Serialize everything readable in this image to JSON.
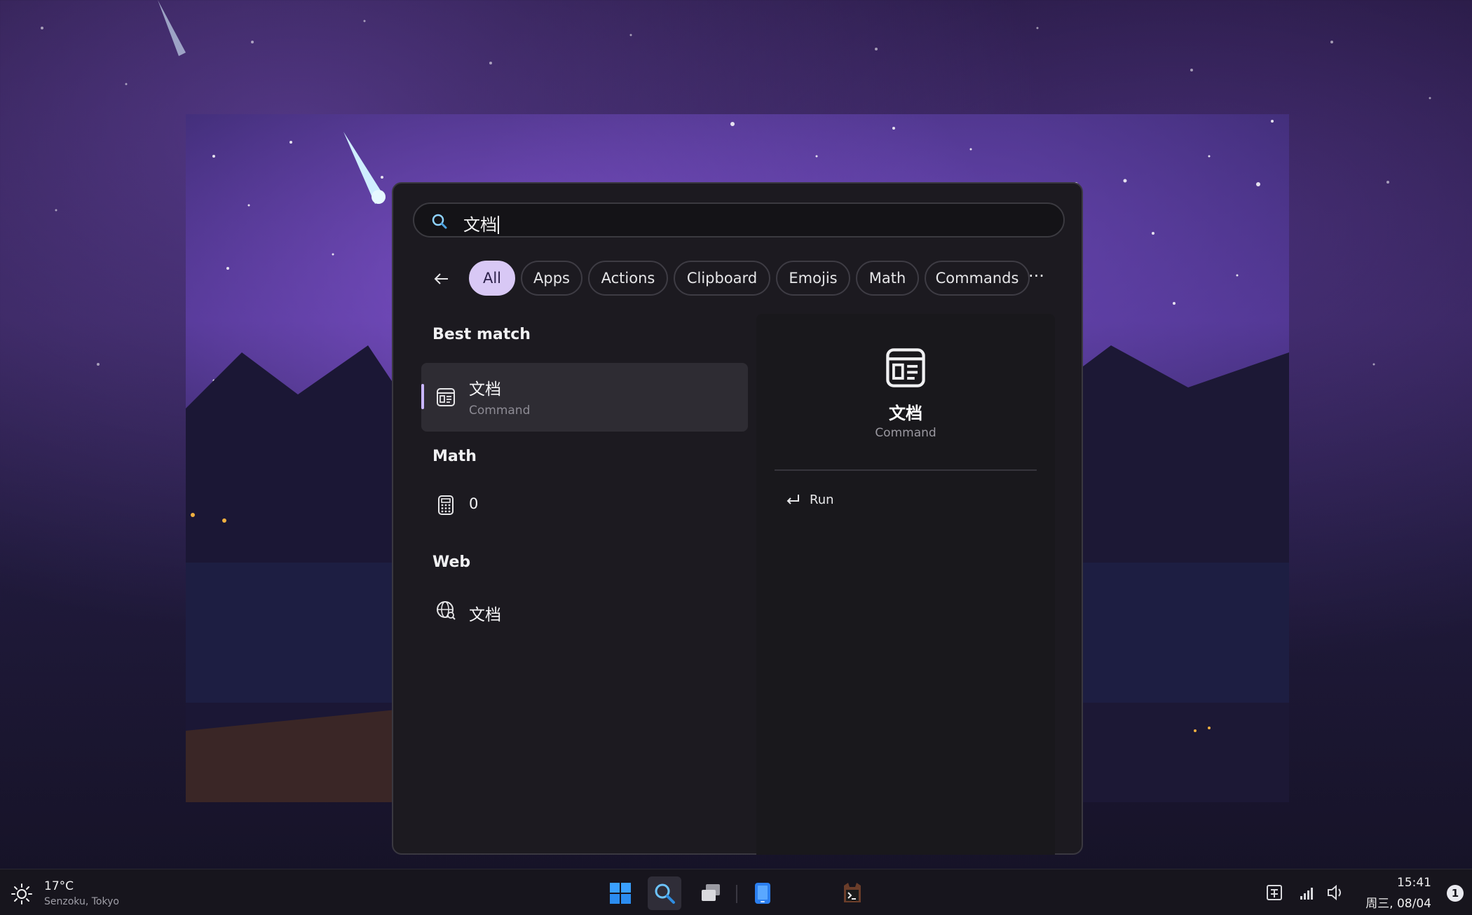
{
  "search": {
    "query": "文档"
  },
  "filters": {
    "chips": [
      "All",
      "Apps",
      "Actions",
      "Clipboard",
      "Emojis",
      "Math",
      "Commands"
    ],
    "more": "···",
    "active": "All"
  },
  "results": {
    "best_match": {
      "title": "Best match",
      "item": {
        "title": "文档",
        "subtitle": "Command",
        "icon": "document-icon"
      }
    },
    "math": {
      "title": "Math",
      "item": {
        "value": "0",
        "icon": "calculator-icon"
      }
    },
    "web": {
      "title": "Web",
      "item": {
        "title": "文档",
        "icon": "web-search-icon"
      }
    }
  },
  "details": {
    "title": "文档",
    "subtitle": "Command",
    "icon": "document-icon",
    "action": {
      "label": "Run",
      "icon": "enter-icon"
    }
  },
  "taskbar": {
    "weather": {
      "temperature": "17°C",
      "location": "Senzoku, Tokyo",
      "icon": "sun-icon"
    },
    "apps": [
      "windows-start-icon",
      "search-icon",
      "task-view-icon",
      "phone-app-icon",
      "terminal-app-icon"
    ],
    "tray": [
      "input-method-icon",
      "network-icon",
      "volume-icon"
    ],
    "clock": {
      "time": "15:41",
      "date": "周三, 08/04"
    },
    "notifications": "1"
  },
  "colors": {
    "accent": "#d8c8f5",
    "panel": "#1c1a20",
    "selected_row": "#2e2c33"
  }
}
